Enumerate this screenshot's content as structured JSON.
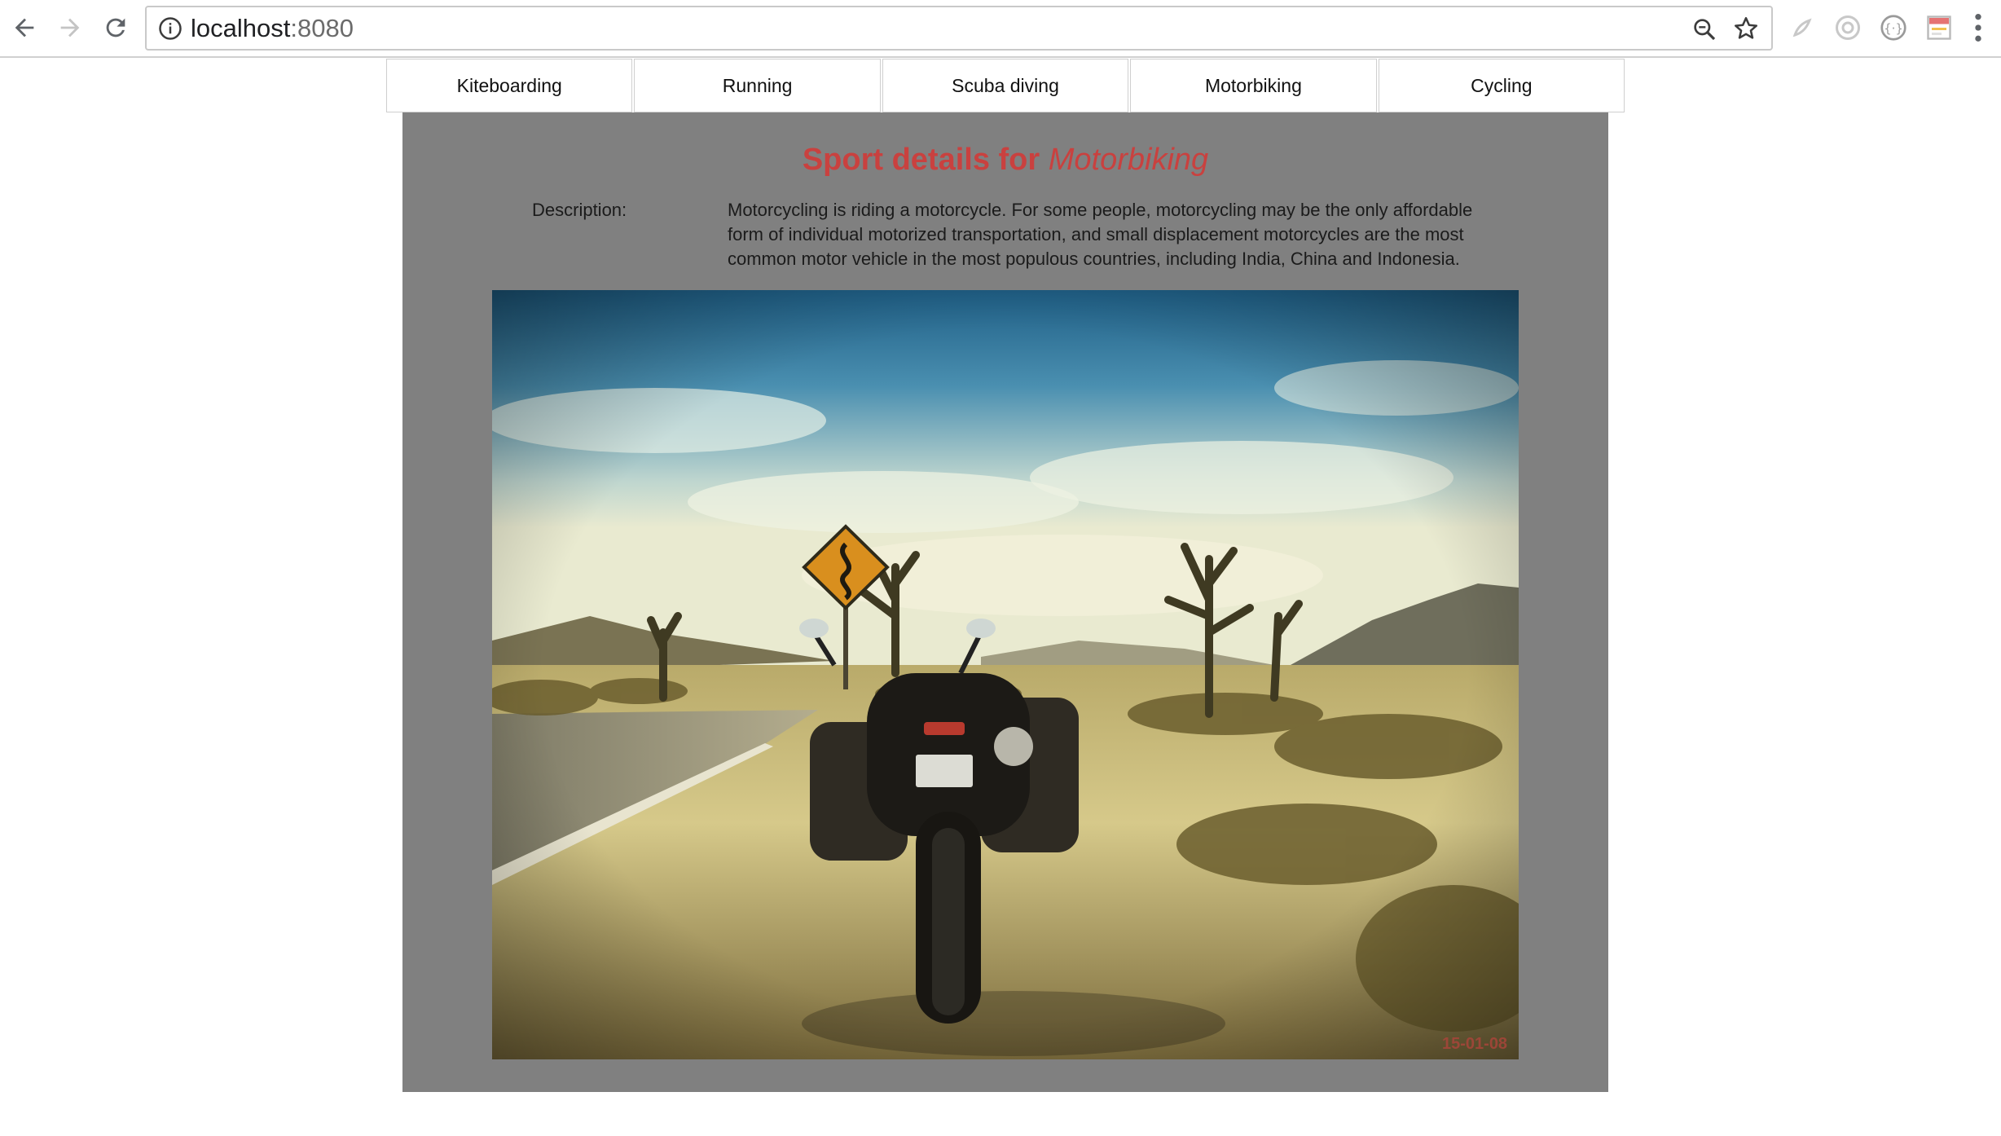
{
  "browser": {
    "url_host": "localhost",
    "url_port": ":8080",
    "icons": [
      "back-icon",
      "forward-icon",
      "reload-icon",
      "info-icon",
      "zoom-icon",
      "star-icon",
      "extension-icon",
      "menu-icon"
    ]
  },
  "tabs": [
    {
      "label": "Kiteboarding"
    },
    {
      "label": "Running"
    },
    {
      "label": "Scuba diving"
    },
    {
      "label": "Motorbiking"
    },
    {
      "label": "Cycling"
    }
  ],
  "detail": {
    "title_prefix": "Sport details for",
    "sport_name": "Motorbiking",
    "description_label": "Description:",
    "description_text": "Motorcycling is riding a motorcycle. For some people, motorcycling may be the only affordable form of individual motorized transportation, and small displacement motorcycles are the most common motor vehicle in the most populous countries, including India, China and Indonesia.",
    "photo_datestamp": "15-01-08"
  },
  "colors": {
    "title": "#c9413f",
    "panel": "#808080"
  }
}
